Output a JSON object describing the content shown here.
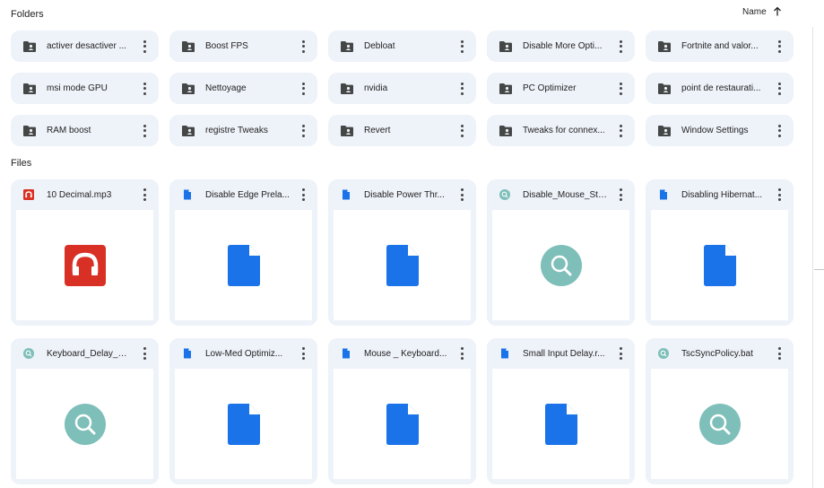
{
  "folders_section": {
    "title": "Folders"
  },
  "sort": {
    "label": "Name",
    "direction_icon": "arrow-up-icon"
  },
  "folders": [
    {
      "name": "activer desactiver ..."
    },
    {
      "name": "Boost FPS"
    },
    {
      "name": "Debloat"
    },
    {
      "name": "Disable More Opti..."
    },
    {
      "name": "Fortnite and valor..."
    },
    {
      "name": "msi mode GPU"
    },
    {
      "name": "Nettoyage"
    },
    {
      "name": "nvidia"
    },
    {
      "name": "PC Optimizer"
    },
    {
      "name": "point de restaurati..."
    },
    {
      "name": "RAM boost"
    },
    {
      "name": "registre Tweaks"
    },
    {
      "name": "Revert"
    },
    {
      "name": "Tweaks for connex..."
    },
    {
      "name": "Window Settings"
    }
  ],
  "files_section": {
    "title": "Files"
  },
  "files": [
    {
      "name": "10 Decimal.mp3",
      "type": "audio"
    },
    {
      "name": "Disable Edge Prela...",
      "type": "doc"
    },
    {
      "name": "Disable Power Thr...",
      "type": "doc"
    },
    {
      "name": "Disable_Mouse_Sti...",
      "type": "script"
    },
    {
      "name": "Disabling Hibernat...",
      "type": "doc"
    },
    {
      "name": "Keyboard_Delay_A...",
      "type": "script"
    },
    {
      "name": "Low-Med Optimiz...",
      "type": "doc"
    },
    {
      "name": "Mouse _ Keyboard...",
      "type": "doc"
    },
    {
      "name": "Small Input Delay.r...",
      "type": "doc"
    },
    {
      "name": "TscSyncPolicy.bat",
      "type": "script"
    }
  ],
  "colors": {
    "card_bg": "#eef2f9",
    "doc_blue": "#1a73e8",
    "audio_red": "#d93025",
    "script_teal": "#7ebfb9"
  }
}
